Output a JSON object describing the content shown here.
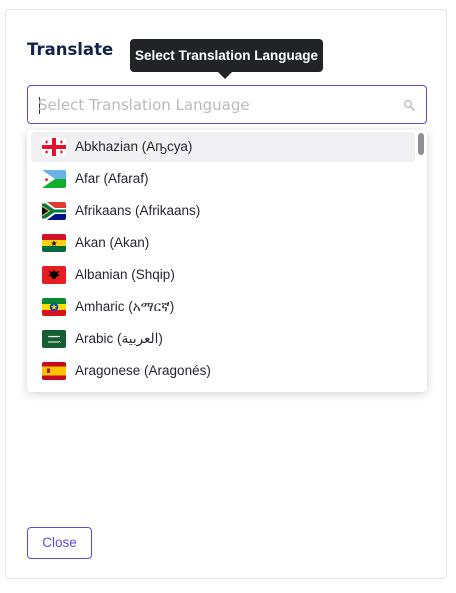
{
  "dialog": {
    "title": "Translate",
    "close_label": "Close"
  },
  "tooltip": {
    "text": "Select Translation Language"
  },
  "search": {
    "placeholder": "Select Translation Language",
    "value": ""
  },
  "languages": [
    {
      "label": "Abkhazian (Аҧсуа)",
      "flag": "georgia-flag-icon",
      "selected": true
    },
    {
      "label": "Afar (Afaraf)",
      "flag": "djibouti-flag-icon",
      "selected": false
    },
    {
      "label": "Afrikaans (Afrikaans)",
      "flag": "south-africa-flag-icon",
      "selected": false
    },
    {
      "label": "Akan (Akan)",
      "flag": "ghana-flag-icon",
      "selected": false
    },
    {
      "label": "Albanian (Shqip)",
      "flag": "albania-flag-icon",
      "selected": false
    },
    {
      "label": "Amharic (አማርኛ)",
      "flag": "ethiopia-flag-icon",
      "selected": false
    },
    {
      "label": "Arabic (العربية)",
      "flag": "saudi-arabia-flag-icon",
      "selected": false
    },
    {
      "label": "Aragonese (Aragonés)",
      "flag": "spain-flag-icon",
      "selected": false
    }
  ],
  "colors": {
    "accent": "#5a4bdb",
    "title": "#13234a",
    "tooltip_bg": "#222327"
  }
}
